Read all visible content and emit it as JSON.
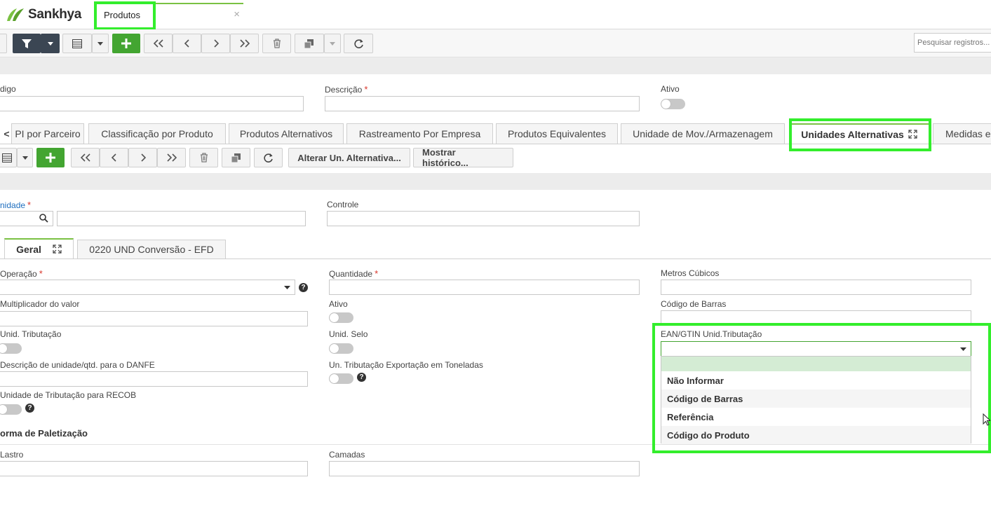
{
  "app": {
    "brand": "Sankhya",
    "tab_title": "Produtos",
    "close_symbol": "×"
  },
  "search": {
    "placeholder": "Pesquisar registros..."
  },
  "main_form": {
    "codigo_label": "digo",
    "descricao_label": "Descrição",
    "ativo_label": "Ativo",
    "required_mark": "*"
  },
  "tabs": [
    {
      "label": "PI por Parceiro"
    },
    {
      "label": "Classificação por Produto"
    },
    {
      "label": "Produtos Alternativos"
    },
    {
      "label": "Rastreamento Por Empresa"
    },
    {
      "label": "Produtos Equivalentes"
    },
    {
      "label": "Unidade de Mov./Armazenagem"
    },
    {
      "label": "Unidades Alternativas"
    },
    {
      "label": "Medidas e"
    }
  ],
  "tabs_scroll_left": "<",
  "sub_toolbar": {
    "alterar_label": "Alterar Un. Alternativa...",
    "historico_label": "Mostrar histórico..."
  },
  "unit_form": {
    "unidade_label": "nidade",
    "controle_label": "Controle"
  },
  "inner_tabs": [
    {
      "label": "Geral"
    },
    {
      "label": "0220 UND Conversão - EFD"
    }
  ],
  "fields": {
    "operacao": "Operação",
    "quantidade": "Quantidade",
    "metros_cubicos": "Metros Cúbicos",
    "multiplicador": "Multiplicador do valor",
    "ativo": "Ativo",
    "codigo_barras": "Código de Barras",
    "unid_tributacao": "Unid. Tributação",
    "unid_selo": "Unid. Selo",
    "ean_gtin": "EAN/GTIN Unid.Tributação",
    "descricao_danfe": "Descrição de unidade/qtd. para o DANFE",
    "un_trib_export": "Un. Tributação Exportação em Toneladas",
    "unidade_recob": "Unidade de Tributação para RECOB",
    "paletizacao_title": "orma de Paletização",
    "lastro": "Lastro",
    "camadas": "Camadas",
    "help_symbol": "?"
  },
  "ean_dropdown": {
    "options": [
      "Não Informar",
      "Código de Barras",
      "Referência",
      "Código do Produto"
    ]
  },
  "colors": {
    "accent_green": "#43a531",
    "highlight": "#33ee2c",
    "required": "#d9362b",
    "dark_button": "#3b4653"
  }
}
